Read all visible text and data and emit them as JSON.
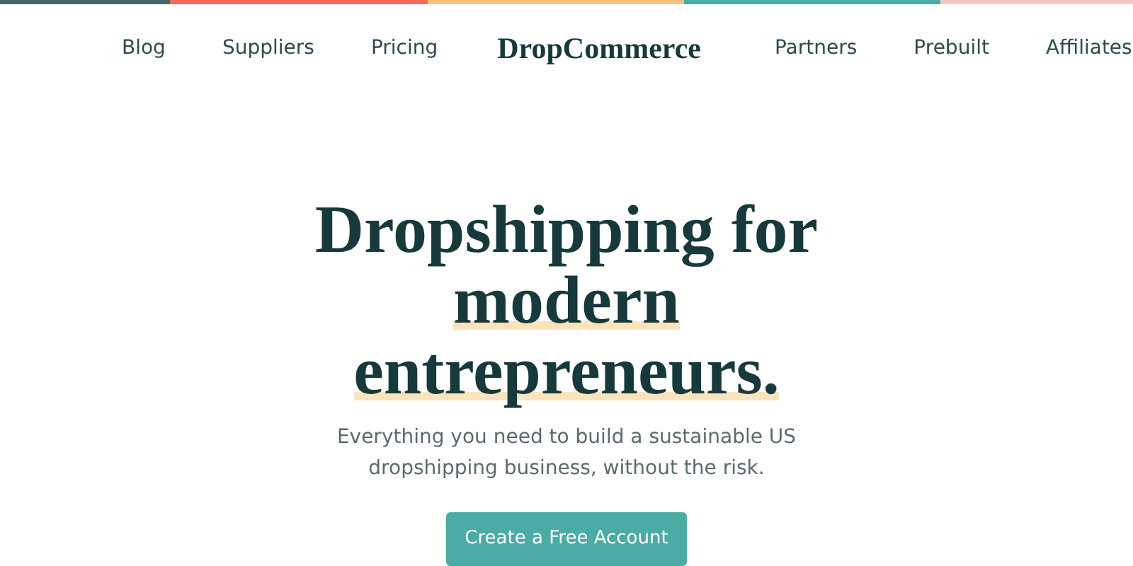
{
  "nav": {
    "left_links": [
      "Blog",
      "Suppliers",
      "Pricing"
    ],
    "logo": "DropCommerce",
    "right_links": [
      "Partners",
      "Prebuilt",
      "Affiliates"
    ]
  },
  "hero": {
    "headline_lines": [
      {
        "text": "Dropshipping for",
        "highlighted": false
      },
      {
        "text": "modern",
        "highlighted": true
      },
      {
        "text": "entrepreneurs.",
        "highlighted": true
      }
    ],
    "subtitle": "Everything you need to build a sustainable US dropshipping business, without the risk.",
    "cta": "Create a Free Account"
  }
}
